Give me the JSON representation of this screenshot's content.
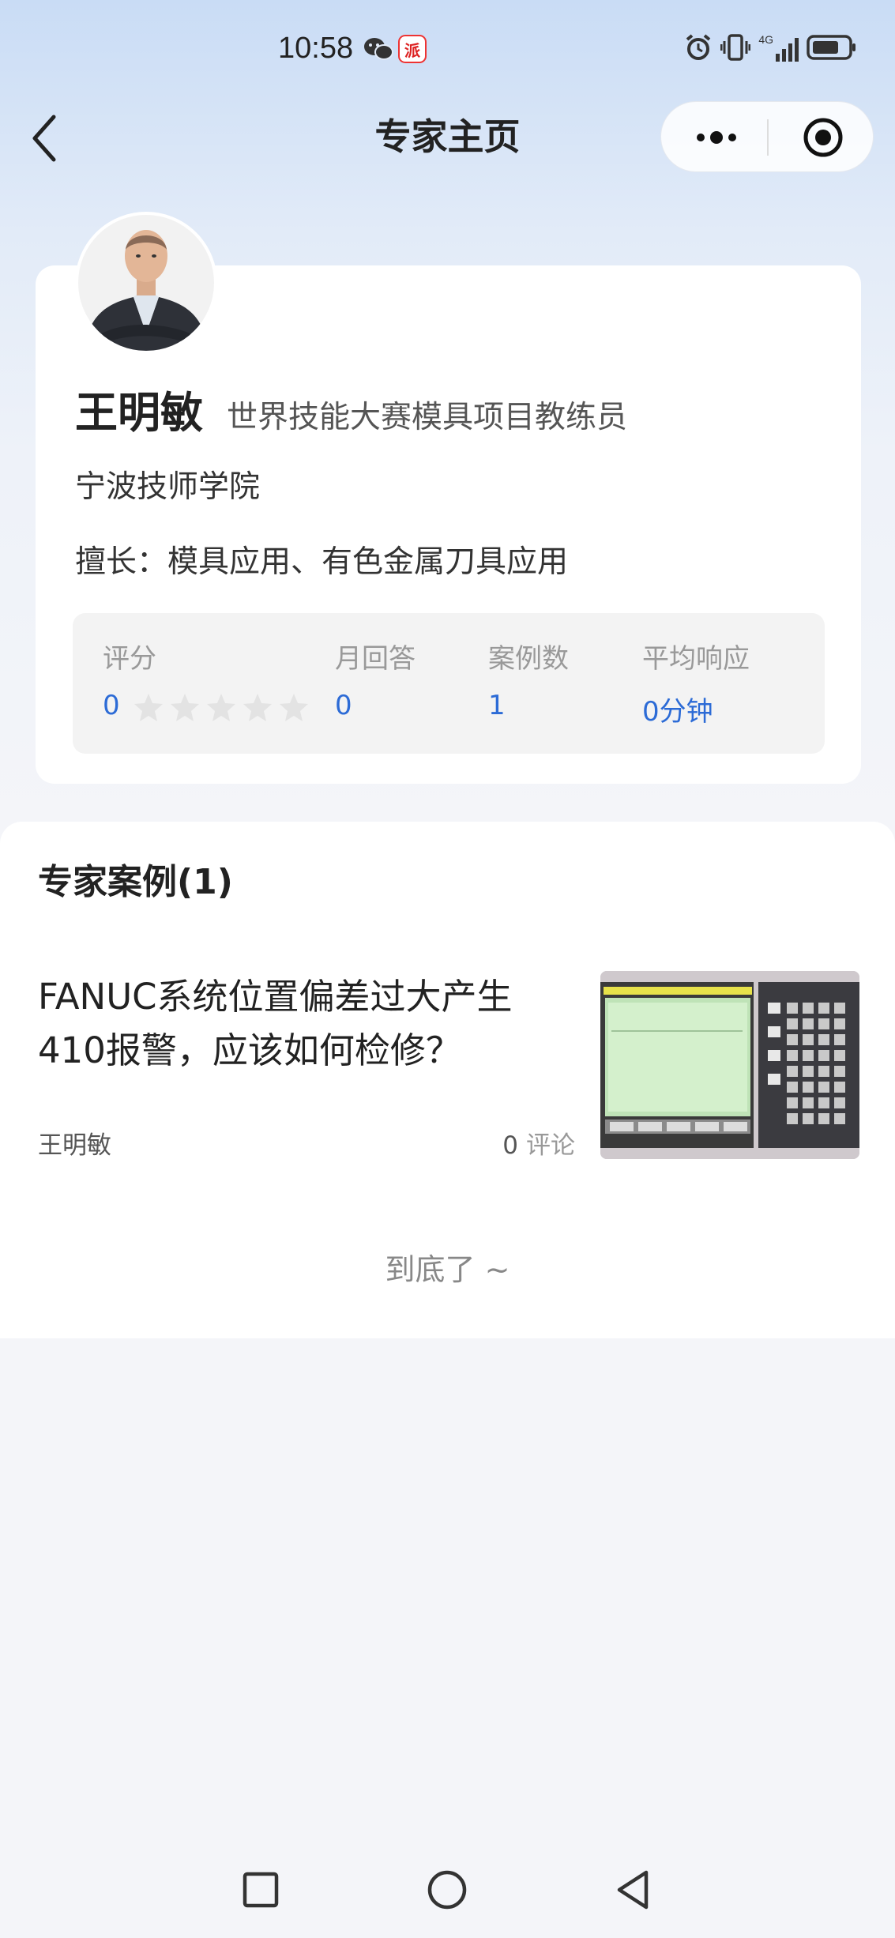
{
  "status_bar": {
    "time": "10:58",
    "app_badge": "派",
    "network": "4G"
  },
  "nav": {
    "title": "专家主页",
    "back_icon": "chevron-left-icon",
    "more_icon": "more-dots-icon",
    "close_icon": "target-close-icon"
  },
  "profile": {
    "name": "王明敏",
    "title": "世界技能大赛模具项目教练员",
    "organization": "宁波技师学院",
    "speciality": "擅长：模具应用、有色金属刀具应用",
    "stats": {
      "rating_label": "评分",
      "rating_value": "0",
      "rating_stars_filled": 0,
      "rating_stars_total": 5,
      "monthly_answers_label": "月回答",
      "monthly_answers_value": "0",
      "cases_label": "案例数",
      "cases_value": "1",
      "avg_response_label": "平均响应",
      "avg_response_value": "0分钟"
    }
  },
  "cases": {
    "section_title": "专家案例(1)",
    "items": [
      {
        "title": "FANUC系统位置偏差过大产生410报警，应该如何检修？",
        "author": "王明敏",
        "comment_count": "0",
        "comment_label": "评论"
      }
    ],
    "end_text": "到底了 ~"
  },
  "colors": {
    "accent": "#2c6bd6",
    "background": "#f4f5f9",
    "card": "#ffffff",
    "stats_bg": "#f3f3f3"
  }
}
